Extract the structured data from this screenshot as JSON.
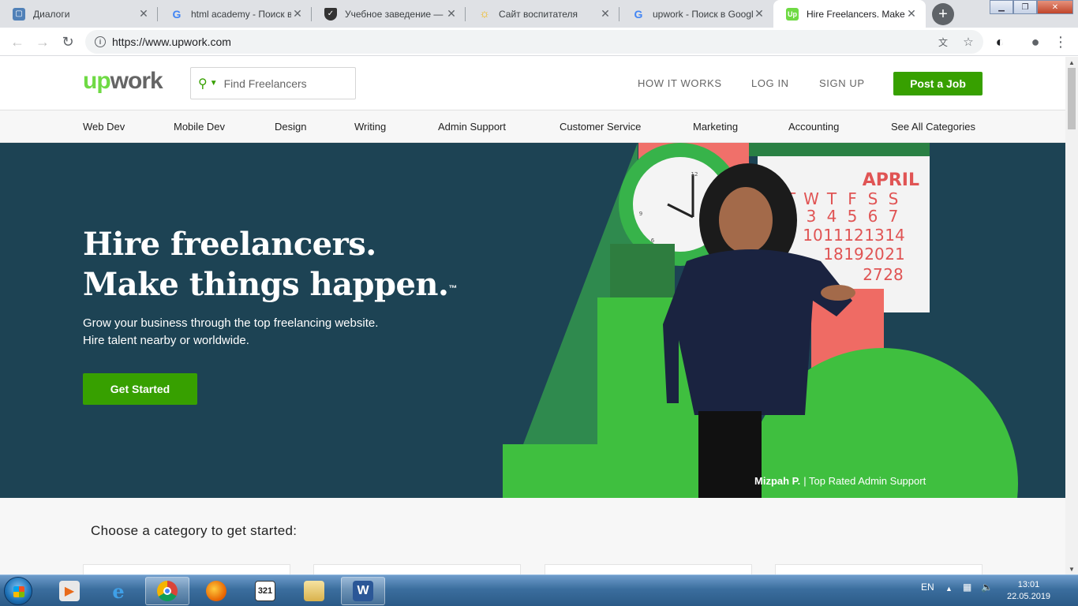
{
  "browser": {
    "tabs": [
      {
        "title": "Диалоги",
        "icon": "vk-dialogs-icon"
      },
      {
        "title": "html academy - Поиск в Google",
        "icon": "google-icon"
      },
      {
        "title": "Учебное заведение — Пик",
        "icon": "shield-icon"
      },
      {
        "title": "Сайт воспитателя",
        "icon": "sun-icon"
      },
      {
        "title": "upwork - Поиск в Google",
        "icon": "google-icon"
      },
      {
        "title": "Hire Freelancers. Make things happen.",
        "icon": "upwork-icon",
        "active": true
      }
    ],
    "url": "https://www.upwork.com",
    "new_tab": "+"
  },
  "site": {
    "logo_up": "up",
    "logo_work": "work",
    "search_placeholder": "Find Freelancers",
    "nav": {
      "how_it_works": "HOW IT WORKS",
      "log_in": "LOG IN",
      "sign_up": "SIGN UP",
      "post_job": "Post a Job"
    },
    "categories": [
      "Web Dev",
      "Mobile Dev",
      "Design",
      "Writing",
      "Admin Support",
      "Customer Service",
      "Marketing",
      "Accounting",
      "See All Categories"
    ],
    "hero": {
      "title_line1": "Hire freelancers.",
      "title_line2": "Make things happen.",
      "trademark": "™",
      "subtitle": "Grow your business through the top freelancing website. Hire talent nearby or worldwide.",
      "cta": "Get Started",
      "caption_name": "Mizpah P.",
      "caption_role": "| Top Rated Admin Support",
      "calendar_month": "APRIL",
      "calendar_days": [
        "T",
        "W",
        "T",
        "F",
        "S",
        "S"
      ],
      "calendar_rows": [
        [
          "3",
          "4",
          "5",
          "6",
          "7"
        ],
        [
          "10",
          "11",
          "12",
          "13",
          "14"
        ],
        [
          "18",
          "19",
          "20",
          "21"
        ],
        [
          "27",
          "28"
        ]
      ],
      "clock_numbers": [
        "12",
        "9",
        "6"
      ]
    },
    "section_title": "Choose a category to get started:"
  },
  "taskbar": {
    "language": "EN",
    "time": "13:01",
    "date": "22.05.2019",
    "apps": [
      "media-player-icon",
      "internet-explorer-icon",
      "chrome-icon",
      "firefox-icon",
      "media-player-classic-icon",
      "file-explorer-icon",
      "word-icon"
    ]
  },
  "colors": {
    "upwork_green": "#37a000",
    "hero_bg": "#1d4354",
    "accent_green": "#6fda44"
  }
}
